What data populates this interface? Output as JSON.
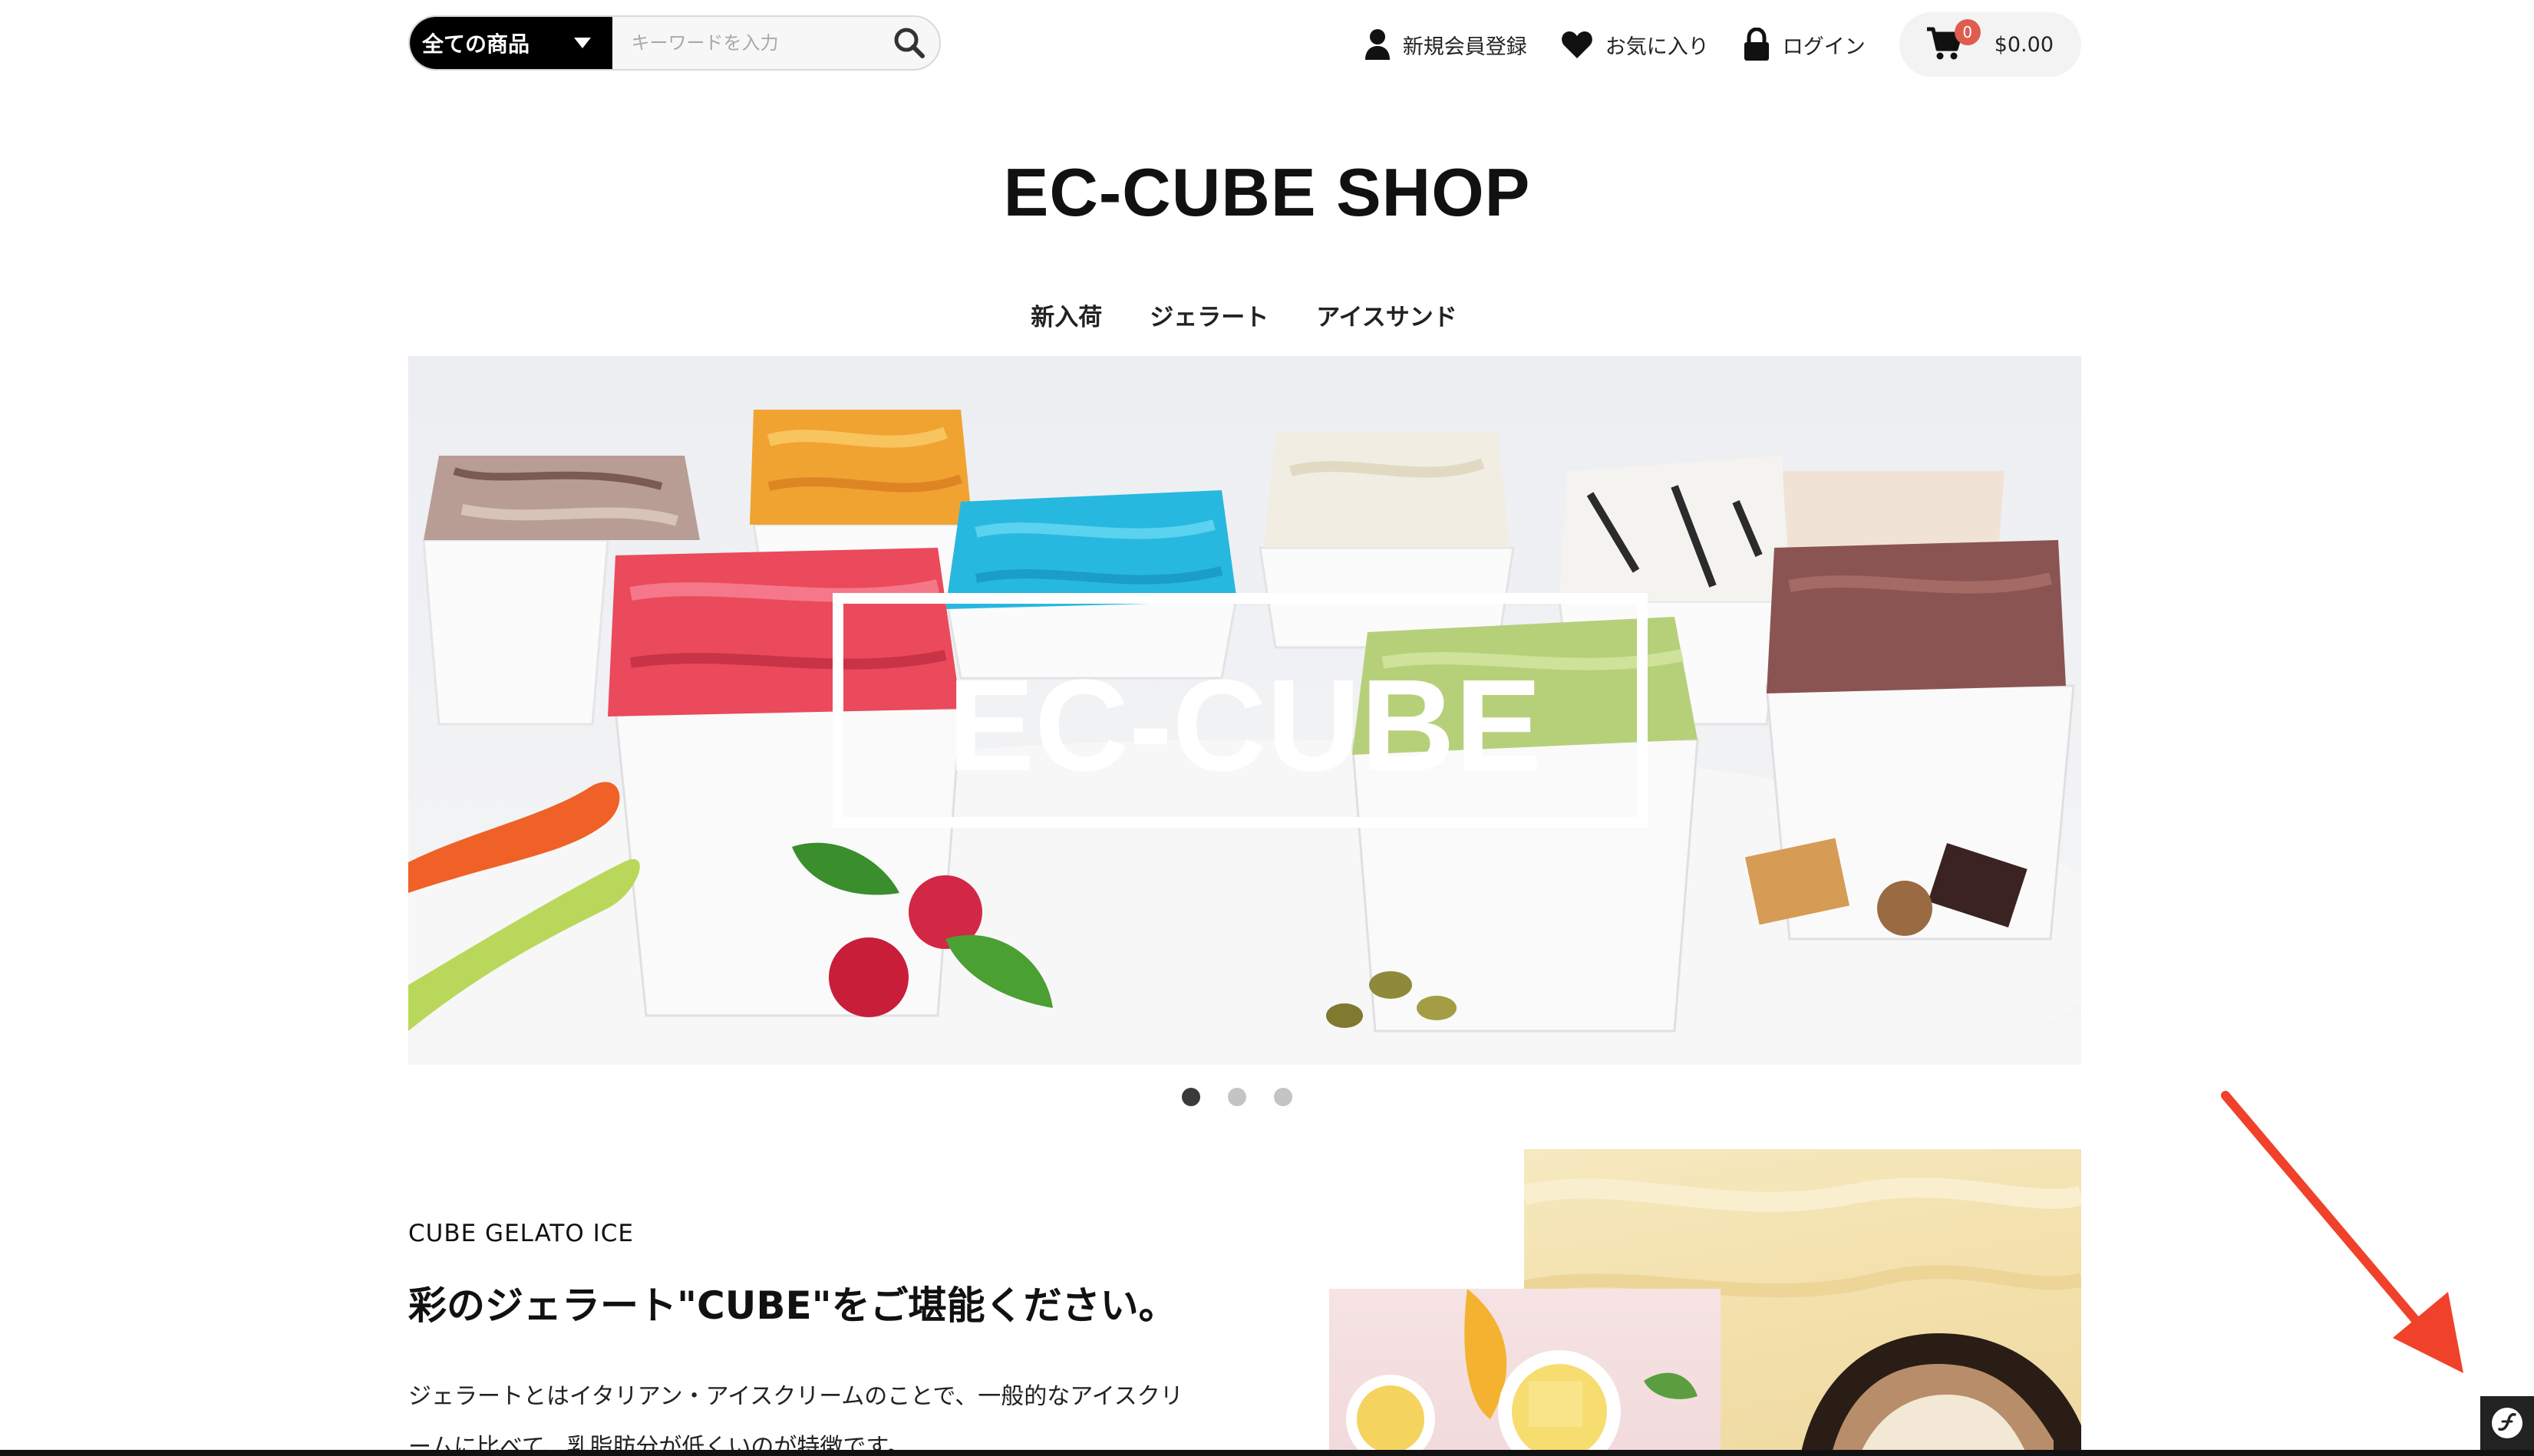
{
  "header": {
    "category_select": "全ての商品",
    "search_placeholder": "キーワードを入力",
    "links": {
      "register": "新規会員登録",
      "favorites": "お気に入り",
      "login": "ログイン"
    },
    "cart": {
      "count": "0",
      "total": "$0.00"
    }
  },
  "logo": "EC-CUBE SHOP",
  "gnav": [
    "新入荷",
    "ジェラート",
    "アイスサンド"
  ],
  "hero": {
    "overlay_text": "EC-CUBE",
    "slide_count": 3,
    "active_slide": 1
  },
  "about": {
    "eyebrow": "CUBE GELATO ICE",
    "headline": "彩のジェラート\"CUBE\"をご堪能ください。",
    "body_line1": "ジェラートとはイタリアン・アイスクリームのことで、一般的なアイスクリ",
    "body_line2": "ームに比べて、乳脂肪分が低くいのが特徴です。"
  },
  "colors": {
    "accent": "#de5d50",
    "annotation_arrow": "#f0412a"
  }
}
